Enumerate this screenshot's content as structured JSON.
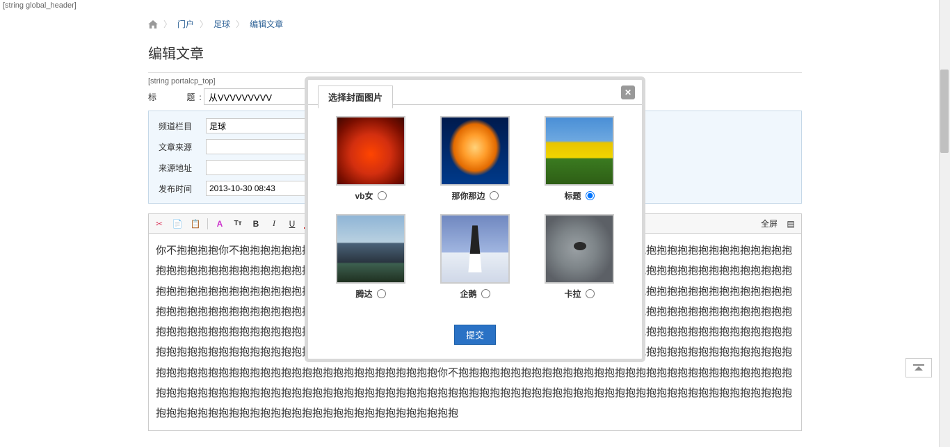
{
  "header_string": "[string global_header]",
  "breadcrumb": {
    "items": [
      "门户",
      "足球",
      "编辑文章"
    ]
  },
  "page_title": "编辑文章",
  "portalcp_string": "[string portalcp_top]",
  "form": {
    "title_label": "标",
    "title_label2": "题:",
    "title_value": "从VVVVVVVVV",
    "channel_label": "频道栏目",
    "channel_value": "足球",
    "source_label": "文章来源",
    "source_value": "",
    "sourceurl_label": "来源地址",
    "sourceurl_value": "",
    "pubtime_label": "发布时间",
    "pubtime_value": "2013-10-30 08:43"
  },
  "toolbar": {
    "fullscreen": "全屏"
  },
  "editor_content": "你不抱抱抱抱你不抱抱抱抱抱抱抱抱抱抱抱抱抱抱抱抱抱抱抱抱抱抱抱抱抱抱抱抱抱抱抱抱抱抱抱抱抱抱抱抱抱抱抱抱抱抱抱抱抱抱抱抱抱抱抱抱抱抱抱抱抱抱抱抱抱抱抱抱抱抱抱抱抱抱抱抱抱抱抱抱抱抱抱抱抱抱抱抱抱抱抱抱抱抱抱抱抱抱抱抱抱抱抱抱抱抱抱抱抱抱抱抱抱抱抱抱抱抱抱抱抱抱抱抱抱抱抱抱抱抱抱抱你不抱抱抱抱抱抱抱抱抱抱抱抱抱抱抱抱抱抱抱抱抱抱抱抱抱抱抱抱抱抱抱抱抱抱抱抱抱抱抱抱抱抱抱抱抱抱抱抱抱抱抱抱抱抱抱抱抱抱抱抱抱抱抱抱抱抱抱抱抱抱抱抱抱抱抱抱抱抱抱抱抱抱抱抱你不抱抱抱抱抱抱抱抱抱抱抱抱抱抱抱抱抱抱抱抱抱抱抱抱抱抱抱抱抱抱抱抱抱抱抱抱抱抱抱抱抱抱抱抱抱抱抱抱抱抱抱抱抱抱抱抱抱抱抱抱抱抱抱抱抱抱抱抱抱抱抱抱抱抱抱抱抱抱抱抱抱抱抱抱抱抱抱抱抱抱抱抱你不抱抱抱抱抱抱抱抱抱抱抱抱抱抱抱抱抱抱抱抱抱抱抱抱抱抱抱抱抱抱抱抱抱抱抱抱抱抱抱抱抱抱抱抱抱抱抱抱抱抱抱抱抱抱抱抱抱抱抱抱抱抱抱抱抱抱抱抱抱抱抱你不抱抱抱抱抱抱抱抱抱抱抱抱抱抱抱抱抱抱抱抱抱抱抱抱抱抱抱抱抱抱抱抱抱抱抱抱抱抱抱抱抱抱抱抱抱抱抱抱抱抱抱抱抱抱抱抱抱抱抱抱抱抱抱抱抱抱抱抱抱抱抱抱抱抱抱抱抱抱抱抱抱抱抱抱抱抱抱抱抱抱抱抱抱抱抱抱抱抱抱抱抱抱抱抱抱抱抱抱抱抱抱抱抱抱抱抱抱抱抱抱抱抱",
  "modal": {
    "tab_title": "选择封面图片",
    "items": [
      {
        "label": "vb女",
        "selected": false
      },
      {
        "label": "那你那边",
        "selected": false
      },
      {
        "label": "标题",
        "selected": true
      },
      {
        "label": "腾达",
        "selected": false
      },
      {
        "label": "企鹅",
        "selected": false
      },
      {
        "label": "卡拉",
        "selected": false
      }
    ],
    "submit": "提交"
  }
}
